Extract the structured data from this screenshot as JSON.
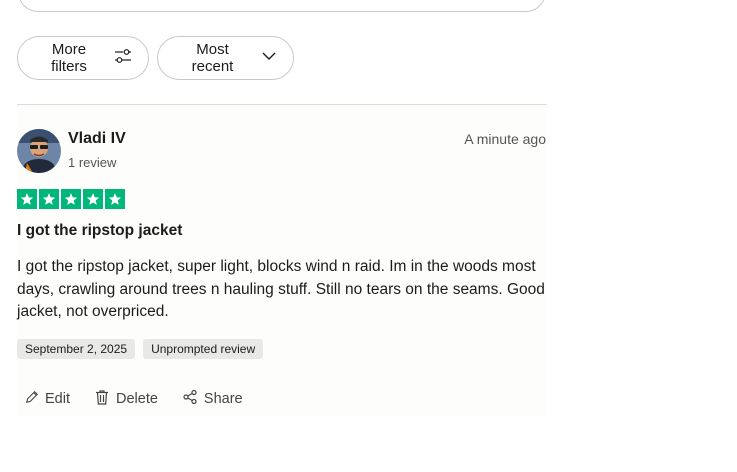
{
  "filters": {
    "more_filters_label": "More filters",
    "sort_label": "Most recent"
  },
  "review": {
    "reviewer_name": "Vladi IV",
    "review_count": "1 review",
    "time_ago": "A minute ago",
    "rating": 5,
    "title": "I got the ripstop jacket",
    "body": "I got the ripstop jacket, super light, blocks wind n raid. Im in the woods most days, crawling around trees n hauling stuff. Still no tears on the seams. Good jacket, not overpriced.",
    "tags": [
      "September 2, 2025",
      "Unprompted review"
    ],
    "actions": {
      "edit_label": "Edit",
      "delete_label": "Delete",
      "share_label": "Share"
    }
  },
  "colors": {
    "star_green": "#00b67a",
    "tag_bg": "#e8e8e6",
    "border": "#c8c8c8"
  },
  "icons": {
    "more_filters": "sliders-icon",
    "sort": "chevron-down-icon",
    "star": "star-icon",
    "edit": "pencil-icon",
    "delete": "trash-icon",
    "share": "share-icon"
  }
}
